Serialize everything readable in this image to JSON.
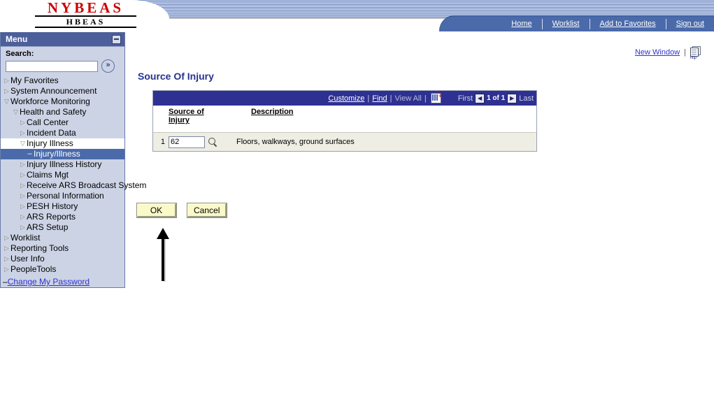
{
  "branding": {
    "logo_main": "NYBEAS",
    "logo_sub": "HBEAS"
  },
  "navbar": {
    "links": [
      "Home",
      "Worklist",
      "Add to Favorites",
      "Sign out"
    ]
  },
  "toolbar": {
    "new_window": "New Window",
    "separator": "|",
    "http_icon_label": "http"
  },
  "sidebar": {
    "title": "Menu",
    "search_label": "Search:",
    "search_value": "",
    "search_placeholder": "",
    "search_go_glyph": "»",
    "collapse_glyph": "–",
    "tree": [
      {
        "label": "My Favorites",
        "level": 0,
        "state": "collapsed",
        "twisty": "▷"
      },
      {
        "label": "System Announcement",
        "level": 0,
        "state": "collapsed",
        "twisty": "▷"
      },
      {
        "label": "Workforce Monitoring",
        "level": 0,
        "state": "expanded",
        "twisty": "▽"
      },
      {
        "label": "Health and Safety",
        "level": 1,
        "state": "expanded",
        "twisty": "▽"
      },
      {
        "label": "Call Center",
        "level": 2,
        "state": "collapsed",
        "twisty": "▷"
      },
      {
        "label": "Incident Data",
        "level": 2,
        "state": "collapsed",
        "twisty": "▷"
      },
      {
        "label": "Injury Illness",
        "level": 2,
        "state": "open-node",
        "twisty": "▽"
      },
      {
        "label": "Injury/Illness",
        "level": 3,
        "state": "selected",
        "twisty": "–"
      },
      {
        "label": "Injury Illness History",
        "level": 2,
        "state": "collapsed",
        "twisty": "▷"
      },
      {
        "label": "Claims Mgt",
        "level": 2,
        "state": "collapsed",
        "twisty": "▷"
      },
      {
        "label": "Receive ARS Broadcast System",
        "level": 2,
        "state": "collapsed",
        "twisty": "▷"
      },
      {
        "label": "Personal Information",
        "level": 2,
        "state": "collapsed",
        "twisty": "▷"
      },
      {
        "label": "PESH History",
        "level": 2,
        "state": "collapsed",
        "twisty": "▷"
      },
      {
        "label": "ARS Reports",
        "level": 2,
        "state": "collapsed",
        "twisty": "▷"
      },
      {
        "label": "ARS Setup",
        "level": 2,
        "state": "collapsed",
        "twisty": "▷"
      },
      {
        "label": "Worklist",
        "level": 0,
        "state": "collapsed",
        "twisty": "▷"
      },
      {
        "label": "Reporting Tools",
        "level": 0,
        "state": "collapsed",
        "twisty": "▷"
      },
      {
        "label": "User Info",
        "level": 0,
        "state": "collapsed",
        "twisty": "▷"
      },
      {
        "label": "PeopleTools",
        "level": 0,
        "state": "collapsed",
        "twisty": "▷"
      }
    ],
    "change_password": "Change My Password",
    "change_password_twisty": "–"
  },
  "main": {
    "page_title": "Source Of Injury",
    "grid": {
      "customize": "Customize",
      "find": "Find",
      "view_all": "View All",
      "download_icon": "grid-download-icon",
      "first": "First",
      "last": "Last",
      "page_indicator": "1 of 1",
      "prev_glyph": "◀",
      "next_glyph": "▶",
      "columns": [
        "Source of Injury",
        "Description"
      ],
      "column_source_line1": "Source of",
      "column_source_line2": "Injury",
      "rows": [
        {
          "num": "1",
          "source_of_injury": "62",
          "description": "Floors, walkways, ground surfaces"
        }
      ]
    },
    "buttons": {
      "ok": "OK",
      "cancel": "Cancel"
    }
  },
  "colors": {
    "accent_blue": "#2e3192",
    "nav_blue": "#4a6aaa",
    "sidebar_bg": "#ccd3e5",
    "selected_row": "#4a6aaa",
    "button_yellow": "#fafac8",
    "logo_red": "#cc0000",
    "link_blue": "#3333cc",
    "row_bg": "#eeeee4"
  }
}
